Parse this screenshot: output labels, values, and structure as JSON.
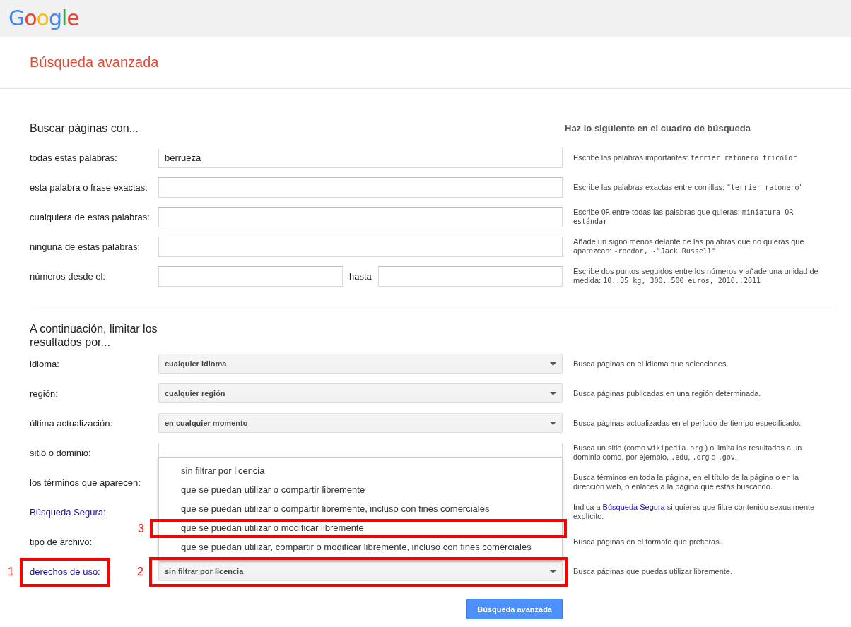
{
  "header": {
    "logo": "Google"
  },
  "title": "Búsqueda avanzada",
  "sections": [
    {
      "heading": "Buscar páginas con...",
      "help_heading": "Haz lo siguiente en el cuadro de búsqueda",
      "rows": [
        {
          "label": "todas estas palabras:",
          "kind": "text",
          "value": "berrueza",
          "help": [
            {
              "kind": "plain",
              "text": "Escribe las palabras importantes: "
            },
            {
              "kind": "mono",
              "text": "terrier ratonero tricolor"
            }
          ]
        },
        {
          "label": "esta palabra o frase exactas:",
          "kind": "text",
          "value": "",
          "help": [
            {
              "kind": "plain",
              "text": "Escribe las palabras exactas entre comillas: "
            },
            {
              "kind": "mono",
              "text": "\"terrier ratonero\""
            }
          ]
        },
        {
          "label": "cualquiera de estas palabras:",
          "kind": "text",
          "value": "",
          "help": [
            {
              "kind": "plain",
              "text": "Escribe "
            },
            {
              "kind": "mono",
              "text": "OR"
            },
            {
              "kind": "plain",
              "text": " entre todas las palabras que quieras: "
            },
            {
              "kind": "mono",
              "text": "miniatura OR estándar"
            }
          ]
        },
        {
          "label": "ninguna de estas palabras:",
          "kind": "text",
          "value": "",
          "help": [
            {
              "kind": "plain",
              "text": "Añade un signo menos delante de las palabras que no quieras que aparezcan: "
            },
            {
              "kind": "mono",
              "text": "-roedor, -\"Jack Russell\""
            }
          ]
        },
        {
          "label": "números desde el:",
          "kind": "range",
          "between": "hasta",
          "help": [
            {
              "kind": "plain",
              "text": "Escribe dos puntos seguidos entre los números y añade una unidad de medida: "
            },
            {
              "kind": "mono",
              "text": "10..35 kg, 300..500 euros, 2010..2011"
            }
          ]
        }
      ]
    },
    {
      "heading": "A continuación, limitar los resultados por...",
      "rows": [
        {
          "label": "idioma:",
          "kind": "select",
          "value": "cualquier idioma",
          "help": [
            {
              "kind": "plain",
              "text": "Busca páginas en el idioma que selecciones."
            }
          ]
        },
        {
          "label": "región:",
          "kind": "select",
          "value": "cualquier región",
          "help": [
            {
              "kind": "plain",
              "text": "Busca páginas publicadas en una región determinada."
            }
          ]
        },
        {
          "label": "última actualización:",
          "kind": "select",
          "value": "en cualquier momento",
          "help": [
            {
              "kind": "plain",
              "text": "Busca páginas actualizadas en el período de tiempo especificado."
            }
          ]
        },
        {
          "label": "sitio o dominio:",
          "kind": "text",
          "value": "",
          "help": [
            {
              "kind": "plain",
              "text": "Busca un sitio (como "
            },
            {
              "kind": "mono",
              "text": "wikipedia.org"
            },
            {
              "kind": "plain",
              "text": " ) o limita los resultados a un dominio como, por ejemplo, "
            },
            {
              "kind": "mono",
              "text": ".edu"
            },
            {
              "kind": "plain",
              "text": ", "
            },
            {
              "kind": "mono",
              "text": ".org"
            },
            {
              "kind": "plain",
              "text": " o "
            },
            {
              "kind": "mono",
              "text": ".gov"
            },
            {
              "kind": "plain",
              "text": "."
            }
          ]
        },
        {
          "label": "los términos que aparecen:",
          "kind": "covered",
          "help": [
            {
              "kind": "plain",
              "text": "Busca términos en toda la página, en el título de la página o en la dirección web, o enlaces a la página que estás buscando."
            }
          ]
        },
        {
          "label": "Búsqueda Segura:",
          "label_link": true,
          "kind": "covered",
          "help": [
            {
              "kind": "plain",
              "text": "Indica a "
            },
            {
              "kind": "link",
              "text": "Búsqueda Segura"
            },
            {
              "kind": "plain",
              "text": " si quieres que filtre contenido sexualmente explícito."
            }
          ]
        },
        {
          "label": "tipo de archivo:",
          "kind": "covered",
          "help": [
            {
              "kind": "plain",
              "text": "Busca páginas en el formato que prefieras."
            }
          ]
        },
        {
          "label": "derechos de uso:",
          "label_link": true,
          "label_annotation": "1",
          "kind": "select",
          "value": "sin filtrar por licencia",
          "field_annotation": "2",
          "open": true,
          "options": [
            {
              "text": "sin filtrar por licencia"
            },
            {
              "text": "que se puedan utilizar o compartir libremente"
            },
            {
              "text": "que se puedan utilizar o compartir libremente, incluso con fines comerciales"
            },
            {
              "text": "que se puedan utilizar o modificar libremente",
              "annotation": "3"
            },
            {
              "text": "que se puedan utilizar, compartir o modificar libremente, incluso con fines comerciales"
            }
          ],
          "help": [
            {
              "kind": "plain",
              "text": "Busca páginas que puedas utilizar libremente."
            }
          ]
        }
      ]
    }
  ],
  "submit": "Búsqueda avanzada"
}
